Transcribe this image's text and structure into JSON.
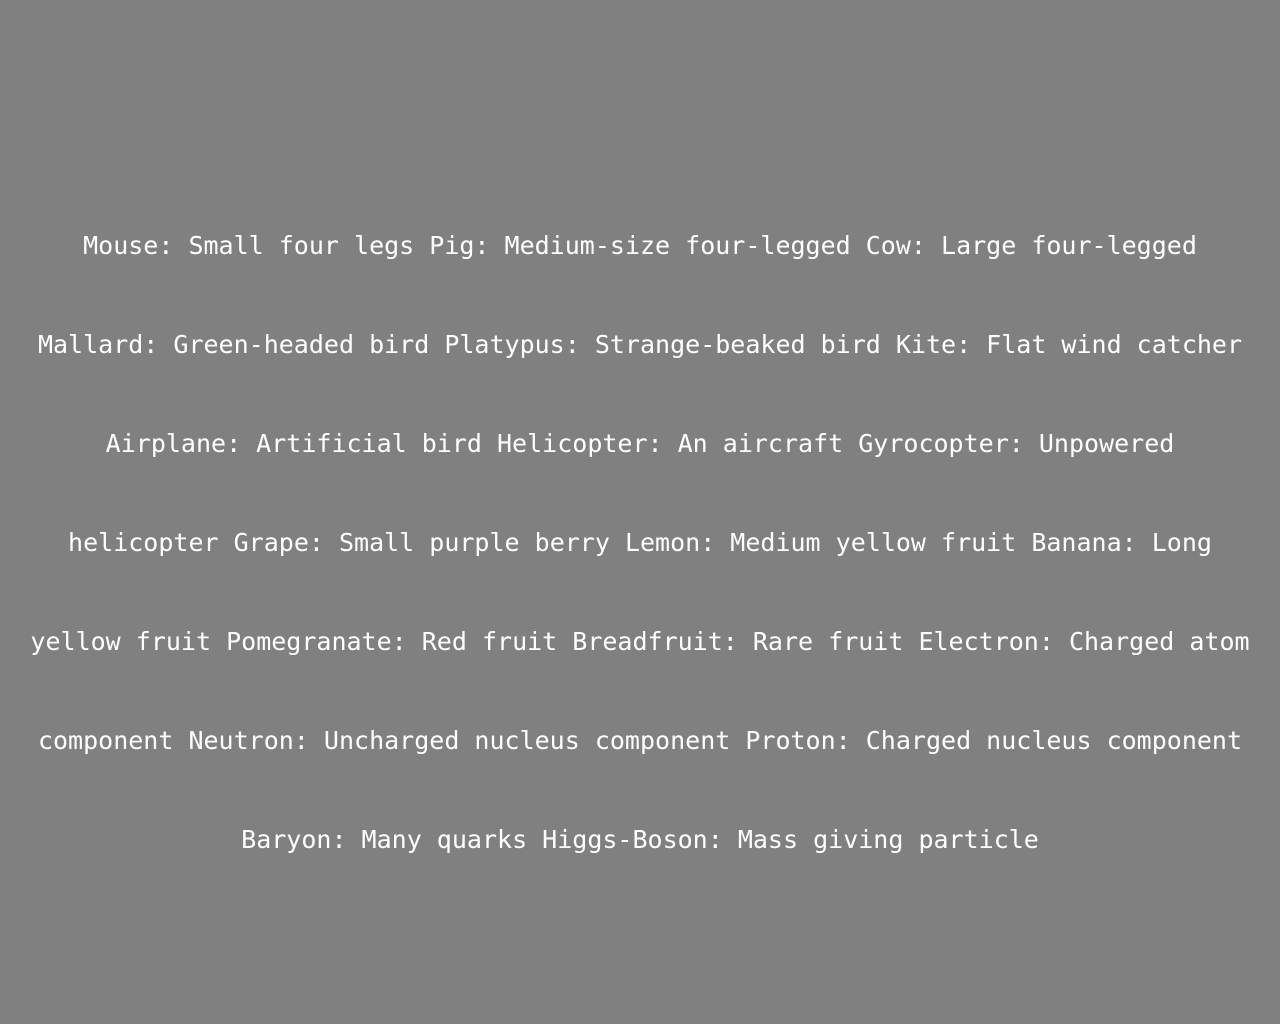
{
  "text": {
    "lines": [
      "Mouse: Small four legs Pig: Medium-size four-legged Cow: Large four-legged",
      "Mallard: Green-headed bird Platypus: Strange-beaked bird Kite: Flat wind catcher",
      "Airplane: Artificial bird Helicopter: An aircraft Gyrocopter: Unpowered",
      "helicopter Grape: Small purple berry Lemon: Medium yellow fruit Banana: Long",
      "yellow fruit Pomegranate: Red fruit Breadfruit: Rare fruit Electron: Charged atom",
      "component Neutron: Uncharged nucleus component Proton: Charged nucleus component",
      "Baryon: Many quarks Higgs-Boson: Mass giving particle"
    ]
  },
  "colors": {
    "background": "#808080",
    "text": "#ffffff"
  }
}
